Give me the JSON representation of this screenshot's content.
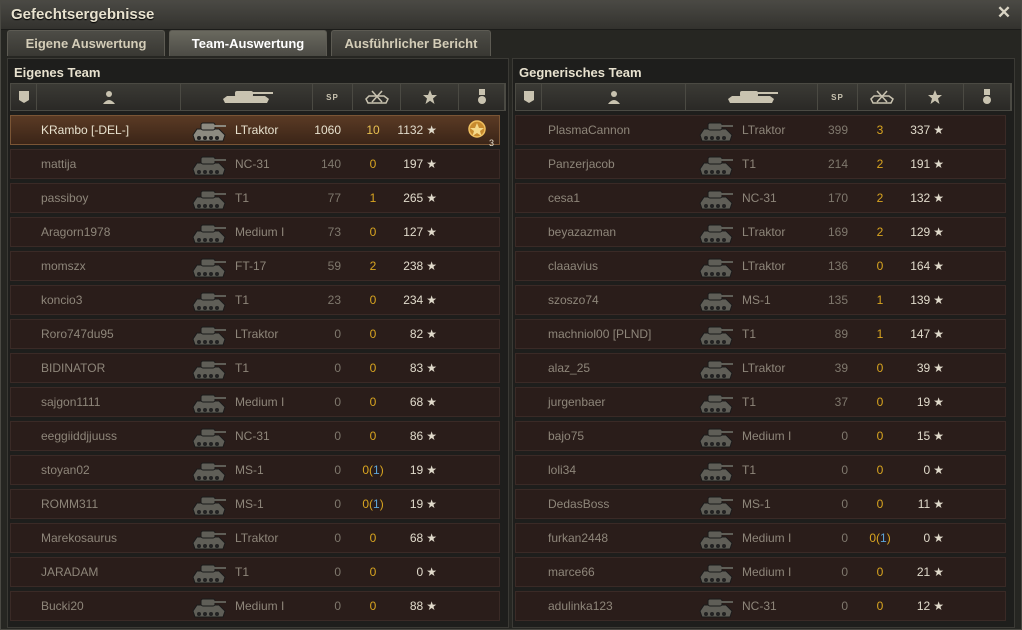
{
  "window": {
    "title": "Gefechtsergebnisse"
  },
  "tabs": [
    {
      "label": "Eigene Auswertung",
      "active": false
    },
    {
      "label": "Team-Auswertung",
      "active": true
    },
    {
      "label": "Ausführlicher Bericht",
      "active": false
    }
  ],
  "columns": {
    "sp": "SP"
  },
  "icons": {
    "close": "close-icon",
    "platoon": "platoon-icon",
    "player": "player-icon",
    "tank": "tank-icon",
    "frags": "destroyed-tank-icon",
    "xp": "star-icon",
    "medal": "medal-icon"
  },
  "colors": {
    "accent": "#d9a520",
    "assist": "#5ea5d9",
    "row_bg": "#2a1d1a",
    "highlight": "#5a3a24"
  },
  "own_team": {
    "title": "Eigenes Team",
    "rows": [
      {
        "player": "KRambo [-DEL-]",
        "tank": "LTraktor",
        "damage": "1060",
        "frags": "10",
        "assist": "",
        "xp": "1132",
        "medal": "3",
        "me": true
      },
      {
        "player": "mattija",
        "tank": "NC-31",
        "damage": "140",
        "frags": "0",
        "assist": "",
        "xp": "197"
      },
      {
        "player": "passiboy",
        "tank": "T1",
        "damage": "77",
        "frags": "1",
        "assist": "",
        "xp": "265"
      },
      {
        "player": "Aragorn1978",
        "tank": "Medium I",
        "damage": "73",
        "frags": "0",
        "assist": "",
        "xp": "127"
      },
      {
        "player": "momszx",
        "tank": "FT-17",
        "damage": "59",
        "frags": "2",
        "assist": "",
        "xp": "238"
      },
      {
        "player": "koncio3",
        "tank": "T1",
        "damage": "23",
        "frags": "0",
        "assist": "",
        "xp": "234"
      },
      {
        "player": "Roro747du95",
        "tank": "LTraktor",
        "damage": "0",
        "frags": "0",
        "assist": "",
        "xp": "82"
      },
      {
        "player": "BIDINATOR",
        "tank": "T1",
        "damage": "0",
        "frags": "0",
        "assist": "",
        "xp": "83"
      },
      {
        "player": "sajgon1111",
        "tank": "Medium I",
        "damage": "0",
        "frags": "0",
        "assist": "",
        "xp": "68"
      },
      {
        "player": "eeggiiddjjuuss",
        "tank": "NC-31",
        "damage": "0",
        "frags": "0",
        "assist": "",
        "xp": "86"
      },
      {
        "player": "stoyan02",
        "tank": "MS-1",
        "damage": "0",
        "frags": "0",
        "assist": "1",
        "xp": "19"
      },
      {
        "player": "ROMM311",
        "tank": "MS-1",
        "damage": "0",
        "frags": "0",
        "assist": "1",
        "xp": "19"
      },
      {
        "player": "Marekosaurus",
        "tank": "LTraktor",
        "damage": "0",
        "frags": "0",
        "assist": "",
        "xp": "68"
      },
      {
        "player": "JARADAM",
        "tank": "T1",
        "damage": "0",
        "frags": "0",
        "assist": "",
        "xp": "0"
      },
      {
        "player": "Bucki20",
        "tank": "Medium I",
        "damage": "0",
        "frags": "0",
        "assist": "",
        "xp": "88"
      }
    ]
  },
  "enemy_team": {
    "title": "Gegnerisches Team",
    "rows": [
      {
        "player": "PlasmaCannon",
        "tank": "LTraktor",
        "damage": "399",
        "frags": "3",
        "assist": "",
        "xp": "337"
      },
      {
        "player": "Panzerjacob",
        "tank": "T1",
        "damage": "214",
        "frags": "2",
        "assist": "",
        "xp": "191"
      },
      {
        "player": "cesa1",
        "tank": "NC-31",
        "damage": "170",
        "frags": "2",
        "assist": "",
        "xp": "132"
      },
      {
        "player": "beyazazman",
        "tank": "LTraktor",
        "damage": "169",
        "frags": "2",
        "assist": "",
        "xp": "129"
      },
      {
        "player": "claaavius",
        "tank": "LTraktor",
        "damage": "136",
        "frags": "0",
        "assist": "",
        "xp": "164"
      },
      {
        "player": "szoszo74",
        "tank": "MS-1",
        "damage": "135",
        "frags": "1",
        "assist": "",
        "xp": "139"
      },
      {
        "player": "machniol00 [PLND]",
        "tank": "T1",
        "damage": "89",
        "frags": "1",
        "assist": "",
        "xp": "147"
      },
      {
        "player": "alaz_25",
        "tank": "LTraktor",
        "damage": "39",
        "frags": "0",
        "assist": "",
        "xp": "39"
      },
      {
        "player": "jurgenbaer",
        "tank": "T1",
        "damage": "37",
        "frags": "0",
        "assist": "",
        "xp": "19"
      },
      {
        "player": "bajo75",
        "tank": "Medium I",
        "damage": "0",
        "frags": "0",
        "assist": "",
        "xp": "15"
      },
      {
        "player": "loli34",
        "tank": "T1",
        "damage": "0",
        "frags": "0",
        "assist": "",
        "xp": "0"
      },
      {
        "player": "DedasBoss",
        "tank": "MS-1",
        "damage": "0",
        "frags": "0",
        "assist": "",
        "xp": "11"
      },
      {
        "player": "furkan2448",
        "tank": "Medium I",
        "damage": "0",
        "frags": "0",
        "assist": "1",
        "xp": "0"
      },
      {
        "player": "marce66",
        "tank": "Medium I",
        "damage": "0",
        "frags": "0",
        "assist": "",
        "xp": "21"
      },
      {
        "player": "adulinka123",
        "tank": "NC-31",
        "damage": "0",
        "frags": "0",
        "assist": "",
        "xp": "12"
      }
    ]
  }
}
